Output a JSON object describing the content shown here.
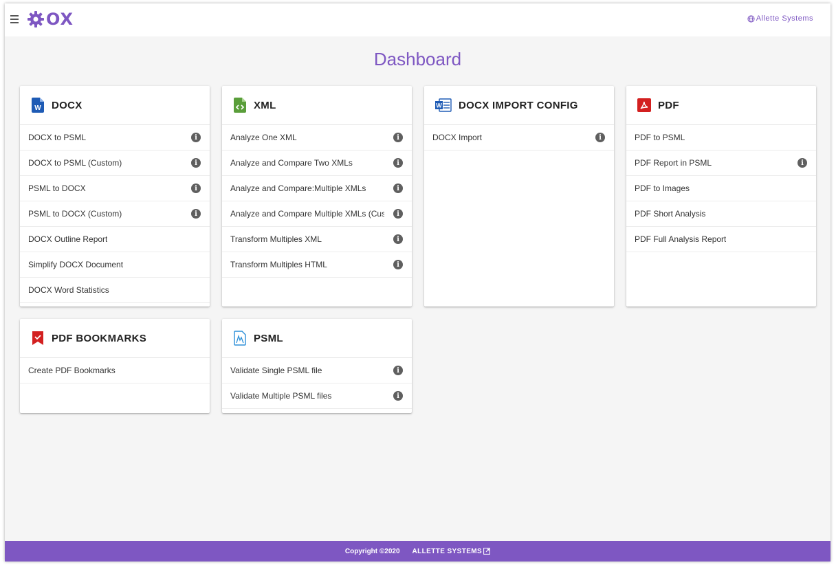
{
  "header": {
    "logo_text": "OX",
    "company": "Allette Systems"
  },
  "page_title": "Dashboard",
  "cards": [
    {
      "title": "DOCX",
      "icon": "word-doc-icon",
      "items": [
        {
          "label": "DOCX to PSML",
          "info": true
        },
        {
          "label": "DOCX to PSML (Custom)",
          "info": true
        },
        {
          "label": "PSML to DOCX",
          "info": true
        },
        {
          "label": "PSML to DOCX (Custom)",
          "info": true
        },
        {
          "label": "DOCX Outline Report",
          "info": false
        },
        {
          "label": "Simplify DOCX Document",
          "info": false
        },
        {
          "label": "DOCX Word Statistics",
          "info": false
        }
      ]
    },
    {
      "title": "XML",
      "icon": "xml-code-icon",
      "items": [
        {
          "label": "Analyze One XML",
          "info": true
        },
        {
          "label": "Analyze and Compare Two XMLs",
          "info": true
        },
        {
          "label": "Analyze and Compare:Multiple XMLs",
          "info": true
        },
        {
          "label": "Analyze and Compare Multiple XMLs (Custom)",
          "info": true
        },
        {
          "label": "Transform Multiples XML",
          "info": true
        },
        {
          "label": "Transform Multiples HTML",
          "info": true
        }
      ]
    },
    {
      "title": "DOCX IMPORT CONFIG",
      "icon": "word-import-icon",
      "items": [
        {
          "label": "DOCX Import",
          "info": true
        }
      ]
    },
    {
      "title": "PDF",
      "icon": "pdf-icon",
      "items": [
        {
          "label": "PDF to PSML",
          "info": false
        },
        {
          "label": "PDF Report in PSML",
          "info": true
        },
        {
          "label": "PDF to Images",
          "info": false
        },
        {
          "label": "PDF Short Analysis",
          "info": false
        },
        {
          "label": "PDF Full Analysis Report",
          "info": false
        }
      ]
    },
    {
      "title": "PDF BOOKMARKS",
      "icon": "bookmark-icon",
      "items": [
        {
          "label": "Create PDF Bookmarks",
          "info": false
        }
      ]
    },
    {
      "title": "PSML",
      "icon": "psml-icon",
      "items": [
        {
          "label": "Validate Single PSML file",
          "info": true
        },
        {
          "label": "Validate Multiple PSML files",
          "info": true
        }
      ]
    }
  ],
  "footer": {
    "copyright": "Copyright ©2020",
    "brand": "ALLETTE SYSTEMS"
  },
  "colors": {
    "accent": "#7e57c2",
    "word_blue": "#1e5bb5",
    "xml_green": "#5a9e3a",
    "pdf_red": "#d32020"
  }
}
